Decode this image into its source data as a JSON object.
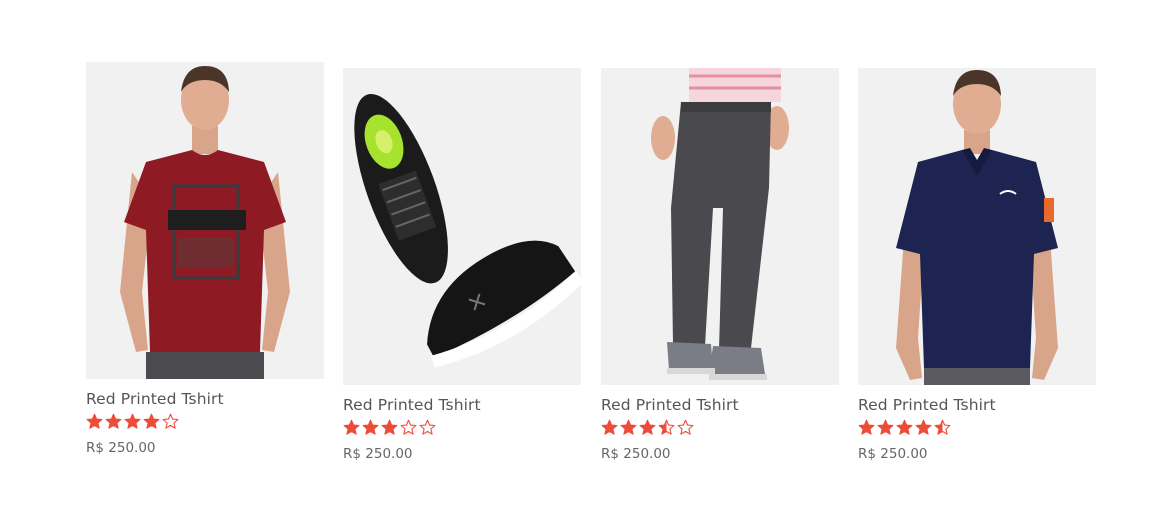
{
  "colors": {
    "star": "#ee4c3a",
    "thumb_bg": "#f1f1f1",
    "title": "#555555",
    "price": "#666666"
  },
  "products": [
    {
      "name": "Red Printed Tshirt",
      "image": "man-red-printed-tshirt",
      "rating": 4,
      "price": "R$ 250.00"
    },
    {
      "name": "Red Printed Tshirt",
      "image": "black-sneakers",
      "rating": 3,
      "price": "R$ 250.00"
    },
    {
      "name": "Red Printed Tshirt",
      "image": "grey-jogger-pants",
      "rating": 3.5,
      "price": "R$ 250.00"
    },
    {
      "name": "Red Printed Tshirt",
      "image": "man-navy-polo-shirt",
      "rating": 4.5,
      "price": "R$ 250.00"
    }
  ]
}
